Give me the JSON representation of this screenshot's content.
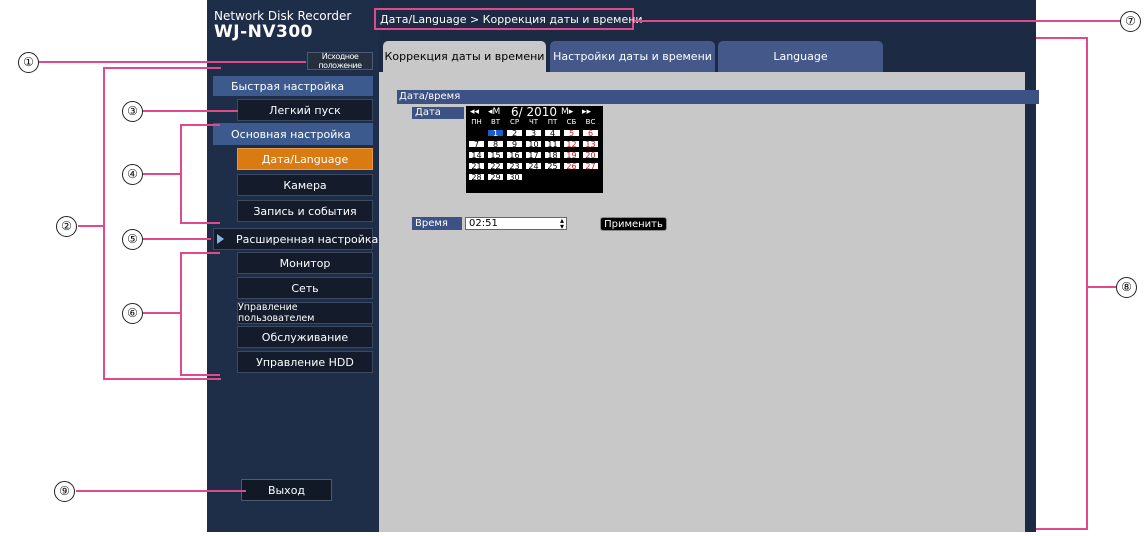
{
  "header": {
    "brand_line1": "Network Disk Recorder",
    "brand_line2": "WJ-NV300",
    "breadcrumb": "Дата/Language > Коррекция даты и времени"
  },
  "sidebar": {
    "home_button": "Исходное положение",
    "quick_setup": "Быстрая настройка",
    "easy_start": "Легкий пуск",
    "basic_setup": "Основная настройка",
    "basic_items": [
      "Дата/Language",
      "Камера",
      "Запись и события"
    ],
    "advanced_setup": "Расширенная настройка",
    "advanced_items": [
      "Монитор",
      "Сеть",
      "Управление пользователем",
      "Обслуживание",
      "Управление HDD"
    ],
    "exit_button": "Выход"
  },
  "tabs": [
    {
      "label": "Коррекция даты и времени",
      "active": true
    },
    {
      "label": "Настройки даты и времени",
      "active": false
    },
    {
      "label": "Language",
      "active": false
    }
  ],
  "content": {
    "section_title": "Дата/время",
    "date_label": "Дата",
    "calendar": {
      "nav_prev_year": "◂◂",
      "nav_prev_month": "◂M",
      "month_year": "6/ 2010",
      "nav_next_month": "M▸",
      "nav_next_year": "▸▸",
      "weekdays": [
        "ПН",
        "ВТ",
        "СР",
        "ЧТ",
        "ПТ",
        "СБ",
        "ВС"
      ],
      "weeks": [
        [
          "",
          "1",
          "2",
          "3",
          "4",
          "5",
          "6"
        ],
        [
          "7",
          "8",
          "9",
          "10",
          "11",
          "12",
          "13"
        ],
        [
          "14",
          "15",
          "16",
          "17",
          "18",
          "19",
          "20"
        ],
        [
          "21",
          "22",
          "23",
          "24",
          "25",
          "26",
          "27"
        ],
        [
          "28",
          "29",
          "30",
          "",
          "",
          "",
          ""
        ],
        [
          "",
          "",
          "",
          "",
          "",
          "",
          ""
        ]
      ],
      "selected_day": "1"
    },
    "time_label": "Время",
    "time_value": "02:51",
    "apply_button": "Применить"
  },
  "annotations": [
    "①",
    "②",
    "③",
    "④",
    "⑤",
    "⑥",
    "⑦",
    "⑧",
    "⑨"
  ],
  "colors": {
    "callout": "#e04a8c",
    "active_item": "#d97b12",
    "section": "#3d5a8e"
  }
}
